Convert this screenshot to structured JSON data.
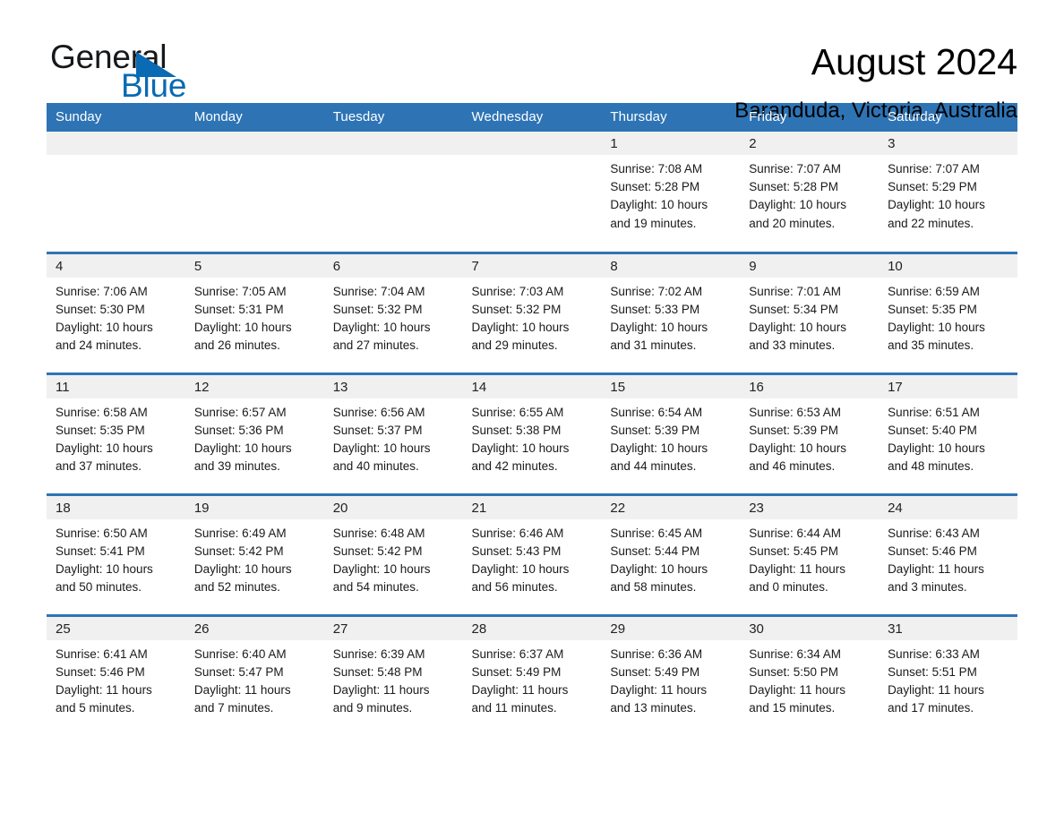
{
  "brand": {
    "name_part1": "General",
    "name_part2": "Blue",
    "accent_color": "#0a6ab4"
  },
  "header": {
    "title": "August 2024",
    "location": "Baranduda, Victoria, Australia"
  },
  "theme": {
    "header_row_bg": "#2e74b5",
    "daynum_band_bg": "#f0f0f0",
    "row_divider": "#2e74b5"
  },
  "weekdays": [
    "Sunday",
    "Monday",
    "Tuesday",
    "Wednesday",
    "Thursday",
    "Friday",
    "Saturday"
  ],
  "labels": {
    "sunrise_prefix": "Sunrise:",
    "sunset_prefix": "Sunset:",
    "daylight_prefix": "Daylight:"
  },
  "weeks": [
    [
      {
        "day": "",
        "blank": true,
        "line1": "",
        "line2": "",
        "line3": "",
        "line4": ""
      },
      {
        "day": "",
        "blank": true,
        "line1": "",
        "line2": "",
        "line3": "",
        "line4": ""
      },
      {
        "day": "",
        "blank": true,
        "line1": "",
        "line2": "",
        "line3": "",
        "line4": ""
      },
      {
        "day": "",
        "blank": true,
        "line1": "",
        "line2": "",
        "line3": "",
        "line4": ""
      },
      {
        "day": "1",
        "blank": false,
        "line1": "Sunrise: 7:08 AM",
        "line2": "Sunset: 5:28 PM",
        "line3": "Daylight: 10 hours",
        "line4": "and 19 minutes."
      },
      {
        "day": "2",
        "blank": false,
        "line1": "Sunrise: 7:07 AM",
        "line2": "Sunset: 5:28 PM",
        "line3": "Daylight: 10 hours",
        "line4": "and 20 minutes."
      },
      {
        "day": "3",
        "blank": false,
        "line1": "Sunrise: 7:07 AM",
        "line2": "Sunset: 5:29 PM",
        "line3": "Daylight: 10 hours",
        "line4": "and 22 minutes."
      }
    ],
    [
      {
        "day": "4",
        "blank": false,
        "line1": "Sunrise: 7:06 AM",
        "line2": "Sunset: 5:30 PM",
        "line3": "Daylight: 10 hours",
        "line4": "and 24 minutes."
      },
      {
        "day": "5",
        "blank": false,
        "line1": "Sunrise: 7:05 AM",
        "line2": "Sunset: 5:31 PM",
        "line3": "Daylight: 10 hours",
        "line4": "and 26 minutes."
      },
      {
        "day": "6",
        "blank": false,
        "line1": "Sunrise: 7:04 AM",
        "line2": "Sunset: 5:32 PM",
        "line3": "Daylight: 10 hours",
        "line4": "and 27 minutes."
      },
      {
        "day": "7",
        "blank": false,
        "line1": "Sunrise: 7:03 AM",
        "line2": "Sunset: 5:32 PM",
        "line3": "Daylight: 10 hours",
        "line4": "and 29 minutes."
      },
      {
        "day": "8",
        "blank": false,
        "line1": "Sunrise: 7:02 AM",
        "line2": "Sunset: 5:33 PM",
        "line3": "Daylight: 10 hours",
        "line4": "and 31 minutes."
      },
      {
        "day": "9",
        "blank": false,
        "line1": "Sunrise: 7:01 AM",
        "line2": "Sunset: 5:34 PM",
        "line3": "Daylight: 10 hours",
        "line4": "and 33 minutes."
      },
      {
        "day": "10",
        "blank": false,
        "line1": "Sunrise: 6:59 AM",
        "line2": "Sunset: 5:35 PM",
        "line3": "Daylight: 10 hours",
        "line4": "and 35 minutes."
      }
    ],
    [
      {
        "day": "11",
        "blank": false,
        "line1": "Sunrise: 6:58 AM",
        "line2": "Sunset: 5:35 PM",
        "line3": "Daylight: 10 hours",
        "line4": "and 37 minutes."
      },
      {
        "day": "12",
        "blank": false,
        "line1": "Sunrise: 6:57 AM",
        "line2": "Sunset: 5:36 PM",
        "line3": "Daylight: 10 hours",
        "line4": "and 39 minutes."
      },
      {
        "day": "13",
        "blank": false,
        "line1": "Sunrise: 6:56 AM",
        "line2": "Sunset: 5:37 PM",
        "line3": "Daylight: 10 hours",
        "line4": "and 40 minutes."
      },
      {
        "day": "14",
        "blank": false,
        "line1": "Sunrise: 6:55 AM",
        "line2": "Sunset: 5:38 PM",
        "line3": "Daylight: 10 hours",
        "line4": "and 42 minutes."
      },
      {
        "day": "15",
        "blank": false,
        "line1": "Sunrise: 6:54 AM",
        "line2": "Sunset: 5:39 PM",
        "line3": "Daylight: 10 hours",
        "line4": "and 44 minutes."
      },
      {
        "day": "16",
        "blank": false,
        "line1": "Sunrise: 6:53 AM",
        "line2": "Sunset: 5:39 PM",
        "line3": "Daylight: 10 hours",
        "line4": "and 46 minutes."
      },
      {
        "day": "17",
        "blank": false,
        "line1": "Sunrise: 6:51 AM",
        "line2": "Sunset: 5:40 PM",
        "line3": "Daylight: 10 hours",
        "line4": "and 48 minutes."
      }
    ],
    [
      {
        "day": "18",
        "blank": false,
        "line1": "Sunrise: 6:50 AM",
        "line2": "Sunset: 5:41 PM",
        "line3": "Daylight: 10 hours",
        "line4": "and 50 minutes."
      },
      {
        "day": "19",
        "blank": false,
        "line1": "Sunrise: 6:49 AM",
        "line2": "Sunset: 5:42 PM",
        "line3": "Daylight: 10 hours",
        "line4": "and 52 minutes."
      },
      {
        "day": "20",
        "blank": false,
        "line1": "Sunrise: 6:48 AM",
        "line2": "Sunset: 5:42 PM",
        "line3": "Daylight: 10 hours",
        "line4": "and 54 minutes."
      },
      {
        "day": "21",
        "blank": false,
        "line1": "Sunrise: 6:46 AM",
        "line2": "Sunset: 5:43 PM",
        "line3": "Daylight: 10 hours",
        "line4": "and 56 minutes."
      },
      {
        "day": "22",
        "blank": false,
        "line1": "Sunrise: 6:45 AM",
        "line2": "Sunset: 5:44 PM",
        "line3": "Daylight: 10 hours",
        "line4": "and 58 minutes."
      },
      {
        "day": "23",
        "blank": false,
        "line1": "Sunrise: 6:44 AM",
        "line2": "Sunset: 5:45 PM",
        "line3": "Daylight: 11 hours",
        "line4": "and 0 minutes."
      },
      {
        "day": "24",
        "blank": false,
        "line1": "Sunrise: 6:43 AM",
        "line2": "Sunset: 5:46 PM",
        "line3": "Daylight: 11 hours",
        "line4": "and 3 minutes."
      }
    ],
    [
      {
        "day": "25",
        "blank": false,
        "line1": "Sunrise: 6:41 AM",
        "line2": "Sunset: 5:46 PM",
        "line3": "Daylight: 11 hours",
        "line4": "and 5 minutes."
      },
      {
        "day": "26",
        "blank": false,
        "line1": "Sunrise: 6:40 AM",
        "line2": "Sunset: 5:47 PM",
        "line3": "Daylight: 11 hours",
        "line4": "and 7 minutes."
      },
      {
        "day": "27",
        "blank": false,
        "line1": "Sunrise: 6:39 AM",
        "line2": "Sunset: 5:48 PM",
        "line3": "Daylight: 11 hours",
        "line4": "and 9 minutes."
      },
      {
        "day": "28",
        "blank": false,
        "line1": "Sunrise: 6:37 AM",
        "line2": "Sunset: 5:49 PM",
        "line3": "Daylight: 11 hours",
        "line4": "and 11 minutes."
      },
      {
        "day": "29",
        "blank": false,
        "line1": "Sunrise: 6:36 AM",
        "line2": "Sunset: 5:49 PM",
        "line3": "Daylight: 11 hours",
        "line4": "and 13 minutes."
      },
      {
        "day": "30",
        "blank": false,
        "line1": "Sunrise: 6:34 AM",
        "line2": "Sunset: 5:50 PM",
        "line3": "Daylight: 11 hours",
        "line4": "and 15 minutes."
      },
      {
        "day": "31",
        "blank": false,
        "line1": "Sunrise: 6:33 AM",
        "line2": "Sunset: 5:51 PM",
        "line3": "Daylight: 11 hours",
        "line4": "and 17 minutes."
      }
    ]
  ]
}
